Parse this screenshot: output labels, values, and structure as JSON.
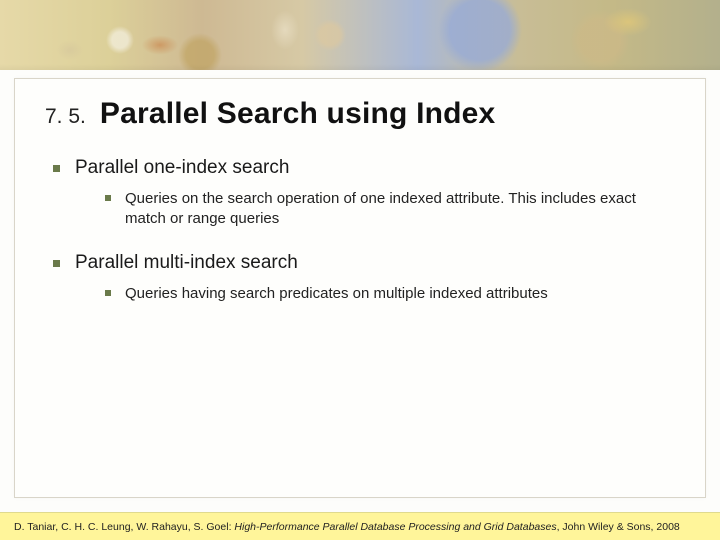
{
  "section_number": "7. 5.",
  "title": "Parallel Search using Index",
  "bullets": [
    {
      "text": "Parallel one-index search",
      "sub": [
        "Queries on the search operation of one indexed attribute. This includes exact match or range queries"
      ]
    },
    {
      "text": "Parallel multi-index search",
      "sub": [
        "Queries having search predicates on multiple indexed attributes"
      ]
    }
  ],
  "footer": {
    "authors": "D. Taniar, C. H. C. Leung, W. Rahayu, S. Goel: ",
    "book_title": "High-Performance Parallel Database Processing and Grid Databases",
    "publisher": ", John Wiley & Sons, 2008"
  }
}
